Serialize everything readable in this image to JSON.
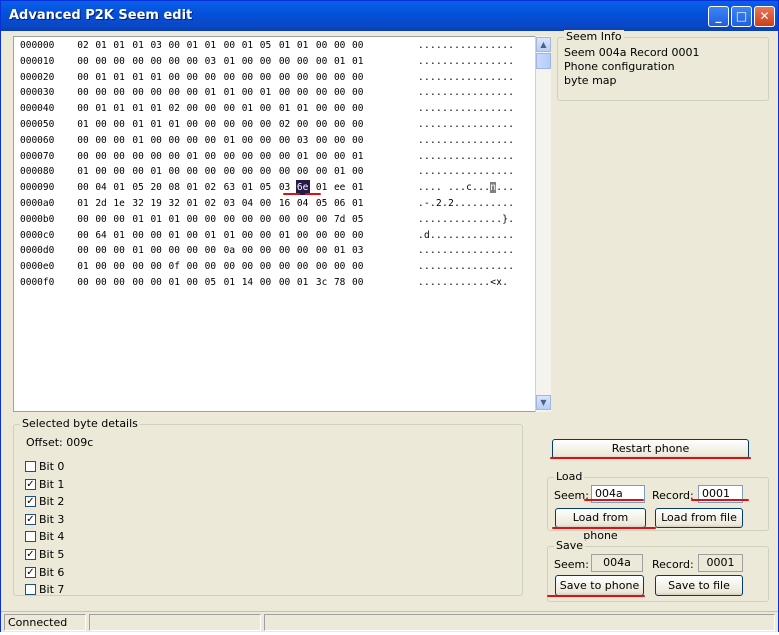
{
  "window": {
    "title": "Advanced P2K Seem edit",
    "minimize": "_",
    "maximize": "□",
    "close": "✕"
  },
  "hex": {
    "rows": [
      {
        "offset": "000000",
        "bytes": [
          "02",
          "01",
          "01",
          "01",
          "03",
          "00",
          "01",
          "01",
          "00",
          "01",
          "05",
          "01",
          "01",
          "00",
          "00",
          "00"
        ],
        "ascii": "................"
      },
      {
        "offset": "000010",
        "bytes": [
          "00",
          "00",
          "00",
          "00",
          "00",
          "00",
          "00",
          "03",
          "01",
          "00",
          "00",
          "00",
          "00",
          "00",
          "01",
          "01"
        ],
        "ascii": "................"
      },
      {
        "offset": "000020",
        "bytes": [
          "00",
          "01",
          "01",
          "01",
          "01",
          "00",
          "00",
          "00",
          "00",
          "00",
          "00",
          "00",
          "00",
          "00",
          "00",
          "00"
        ],
        "ascii": "................"
      },
      {
        "offset": "000030",
        "bytes": [
          "00",
          "00",
          "00",
          "00",
          "00",
          "00",
          "00",
          "01",
          "01",
          "00",
          "01",
          "00",
          "00",
          "00",
          "00",
          "00"
        ],
        "ascii": "................"
      },
      {
        "offset": "000040",
        "bytes": [
          "00",
          "01",
          "01",
          "01",
          "01",
          "02",
          "00",
          "00",
          "00",
          "01",
          "00",
          "01",
          "01",
          "00",
          "00",
          "00"
        ],
        "ascii": "................"
      },
      {
        "offset": "000050",
        "bytes": [
          "01",
          "00",
          "00",
          "01",
          "01",
          "01",
          "00",
          "00",
          "00",
          "00",
          "00",
          "02",
          "00",
          "00",
          "00",
          "00"
        ],
        "ascii": "................"
      },
      {
        "offset": "000060",
        "bytes": [
          "00",
          "00",
          "00",
          "01",
          "00",
          "00",
          "00",
          "00",
          "01",
          "00",
          "00",
          "00",
          "03",
          "00",
          "00",
          "00"
        ],
        "ascii": "................"
      },
      {
        "offset": "000070",
        "bytes": [
          "00",
          "00",
          "00",
          "00",
          "00",
          "00",
          "01",
          "00",
          "00",
          "00",
          "00",
          "00",
          "01",
          "00",
          "00",
          "01"
        ],
        "ascii": "................"
      },
      {
        "offset": "000080",
        "bytes": [
          "01",
          "00",
          "00",
          "00",
          "01",
          "00",
          "00",
          "00",
          "00",
          "00",
          "00",
          "00",
          "00",
          "00",
          "01",
          "00"
        ],
        "ascii": "................"
      },
      {
        "offset": "000090",
        "bytes": [
          "00",
          "04",
          "01",
          "05",
          "20",
          "08",
          "01",
          "02",
          "63",
          "01",
          "05",
          "03",
          "6e",
          "01",
          "ee",
          "01"
        ],
        "ascii": ".... ...c...n..."
      },
      {
        "offset": "0000a0",
        "bytes": [
          "01",
          "2d",
          "1e",
          "32",
          "19",
          "32",
          "01",
          "02",
          "03",
          "04",
          "00",
          "16",
          "04",
          "05",
          "06",
          "01"
        ],
        "ascii": ".-.2.2.........."
      },
      {
        "offset": "0000b0",
        "bytes": [
          "00",
          "00",
          "00",
          "01",
          "01",
          "01",
          "00",
          "00",
          "00",
          "00",
          "00",
          "00",
          "00",
          "00",
          "7d",
          "05"
        ],
        "ascii": "..............}."
      },
      {
        "offset": "0000c0",
        "bytes": [
          "00",
          "64",
          "01",
          "00",
          "00",
          "01",
          "00",
          "01",
          "01",
          "00",
          "00",
          "01",
          "00",
          "00",
          "00",
          "00"
        ],
        "ascii": ".d.............."
      },
      {
        "offset": "0000d0",
        "bytes": [
          "00",
          "00",
          "00",
          "01",
          "00",
          "00",
          "00",
          "00",
          "0a",
          "00",
          "00",
          "00",
          "00",
          "00",
          "01",
          "03"
        ],
        "ascii": "................"
      },
      {
        "offset": "0000e0",
        "bytes": [
          "01",
          "00",
          "00",
          "00",
          "00",
          "0f",
          "00",
          "00",
          "00",
          "00",
          "00",
          "00",
          "00",
          "00",
          "00",
          "00"
        ],
        "ascii": "................"
      },
      {
        "offset": "0000f0",
        "bytes": [
          "00",
          "00",
          "00",
          "00",
          "00",
          "01",
          "00",
          "05",
          "01",
          "14",
          "00",
          "00",
          "01",
          "3c",
          "78",
          "00"
        ],
        "ascii": "............<x."
      }
    ]
  },
  "seem_info": {
    "label": "Seem Info",
    "line1": "Seem 004a Record 0001",
    "line2": "Phone configuration",
    "line3": "byte map"
  },
  "byte_details": {
    "label": "Selected byte details",
    "offset": "Offset: 009c",
    "bits": [
      {
        "label": "Bit 0",
        "checked": false
      },
      {
        "label": "Bit 1",
        "checked": true
      },
      {
        "label": "Bit 2",
        "checked": true
      },
      {
        "label": "Bit 3",
        "checked": true
      },
      {
        "label": "Bit 4",
        "checked": false
      },
      {
        "label": "Bit 5",
        "checked": true
      },
      {
        "label": "Bit 6",
        "checked": true
      },
      {
        "label": "Bit 7",
        "checked": false
      }
    ]
  },
  "restart_button": "Restart phone",
  "load": {
    "label": "Load",
    "seem_label": "Seem:",
    "seem_value": "004a",
    "record_label": "Record:",
    "record_value": "0001",
    "from_phone": "Load from phone",
    "from_file": "Load from file"
  },
  "save": {
    "label": "Save",
    "seem_label": "Seem:",
    "seem_value": "004a",
    "record_label": "Record:",
    "record_value": "0001",
    "to_phone": "Save to phone",
    "to_file": "Save to file"
  },
  "status": {
    "text": "Connected"
  },
  "colors": {
    "annotation": "#e01010",
    "titlebar": "#0451dc",
    "selection": "#2a1a4a"
  }
}
